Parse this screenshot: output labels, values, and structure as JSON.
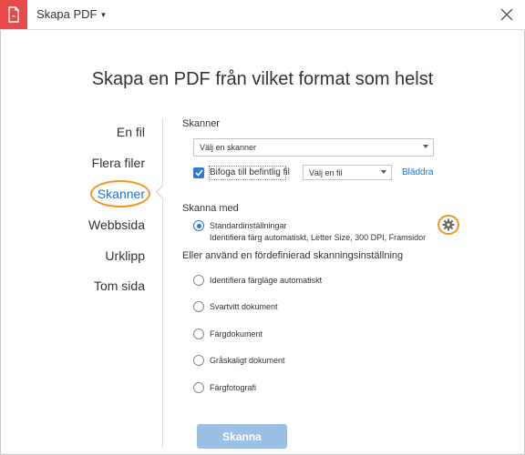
{
  "window": {
    "app_title": "Skapa PDF",
    "app_icon": "pdf-document-icon",
    "close_icon": "close-icon",
    "icon_bg_color": "#e84a4a"
  },
  "heading": "Skapa en PDF från vilket format som helst",
  "nav": {
    "items": [
      {
        "label": "En fil"
      },
      {
        "label": "Flera filer"
      },
      {
        "label": "Skanner"
      },
      {
        "label": "Webbsida"
      },
      {
        "label": "Urklipp"
      },
      {
        "label": "Tom sida"
      }
    ],
    "active": "Skanner",
    "active_color": "#1473e6",
    "highlight_color": "#f29423"
  },
  "scanner": {
    "label": "Skanner",
    "select_value": "Välj en skanner",
    "append_checked": true,
    "append_label": "Bifoga till befintlig fil",
    "file_select_value": "Välj en fil",
    "browse_label": "Bläddra"
  },
  "scan_with": {
    "label": "Skanna med",
    "default_option": "Standardinställningar",
    "default_description": "Identifiera färg automatiskt, Letter Size, 300 DPI, Framsidor",
    "settings_icon": "gear-icon"
  },
  "presets": {
    "label": "Eller använd en fördefinierad skanningsinställning",
    "options": [
      {
        "label": "Identifiera färgläge automatiskt"
      },
      {
        "label": "Svartvitt dokument"
      },
      {
        "label": "Färgdokument"
      },
      {
        "label": "Gråskaligt dokument"
      },
      {
        "label": "Färgfotografi"
      }
    ]
  },
  "actions": {
    "scan_label": "Skanna",
    "scan_color": "#9ac0e6"
  }
}
